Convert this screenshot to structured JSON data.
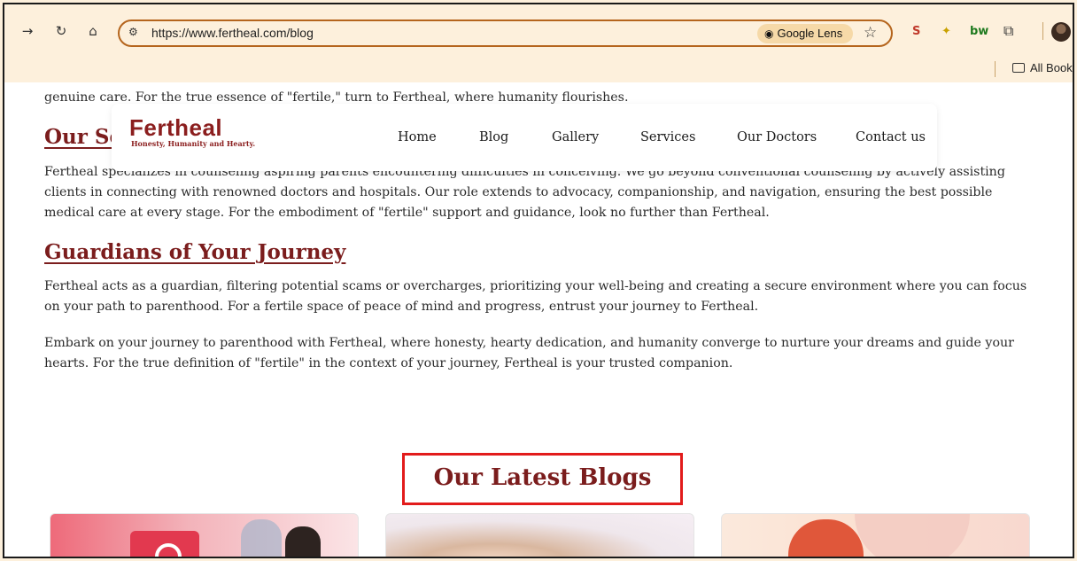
{
  "browser": {
    "url": "https://www.fertheal.com/blog",
    "lens_label": "Google Lens",
    "bookmarks_label": "All Bookm"
  },
  "page": {
    "intro_line": "genuine care. For the true essence of \"fertile,\" turn to Fertheal, where humanity flourishes.",
    "section1_heading_partial": "Our Se",
    "section1_text": "Fertheal specializes in counseling aspiring parents encountering difficulties in conceiving. We go beyond conventional counseling by actively assisting clients in connecting with renowned doctors and hospitals. Our role extends to advocacy, companionship, and navigation, ensuring the best possible medical care at every stage. For the embodiment of \"fertile\" support and guidance, look no further than Fertheal.",
    "section2_heading": "Guardians of Your Journey",
    "section2_text": "Fertheal acts as a guardian, filtering potential scams or overcharges, prioritizing your well-being and creating a secure environment where you can focus on your path to parenthood. For a fertile space of peace of mind and progress, entrust your journey to Fertheal.",
    "section3_text": "Embark on your journey to parenthood with Fertheal, where honesty, hearty dedication, and humanity converge to nurture your dreams and guide your hearts. For the true definition of \"fertile\" in the context of your journey, Fertheal is your trusted companion.",
    "latest_title": "Our Latest Blogs"
  },
  "header": {
    "logo_text": "Fertheal",
    "logo_tagline": "Honesty, Humanity and Hearty.",
    "nav": [
      "Home",
      "Blog",
      "Gallery",
      "Services",
      "Our Doctors",
      "Contact us"
    ]
  },
  "colors": {
    "brand": "#7b1d1d",
    "accent": "#e0631f",
    "highlight_box": "#e21b1b"
  }
}
